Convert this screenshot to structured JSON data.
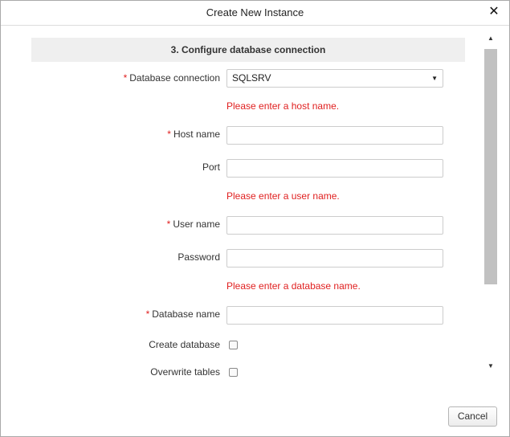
{
  "dialog": {
    "title": "Create New Instance",
    "close_glyph": "✕"
  },
  "section": {
    "header": "3. Configure database connection"
  },
  "form": {
    "database_connection": {
      "required_mark": "*",
      "label": "Database connection",
      "value": "SQLSRV",
      "arrow": "▼"
    },
    "host_error": "Please enter a host name.",
    "host_name": {
      "required_mark": "*",
      "label": "Host name",
      "value": ""
    },
    "port": {
      "label": "Port",
      "value": ""
    },
    "user_error": "Please enter a user name.",
    "user_name": {
      "required_mark": "*",
      "label": "User name",
      "value": ""
    },
    "password": {
      "label": "Password",
      "value": ""
    },
    "database_error": "Please enter a database name.",
    "database_name": {
      "required_mark": "*",
      "label": "Database name",
      "value": ""
    },
    "create_database": {
      "label": "Create database",
      "checked": false
    },
    "overwrite_tables": {
      "label": "Overwrite tables",
      "checked": false
    }
  },
  "scrollbar": {
    "up_arrow": "▲",
    "down_arrow": "▼"
  },
  "footer": {
    "cancel_label": "Cancel"
  }
}
